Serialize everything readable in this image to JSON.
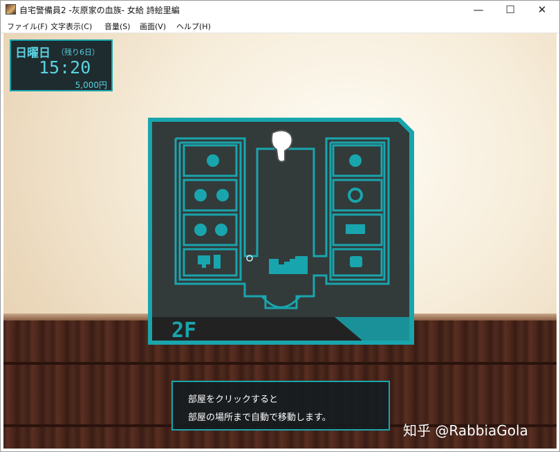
{
  "window": {
    "title": "自宅警備員2 -灰原家の血族- 女給 詩絵里編",
    "minimize_glyph": "—",
    "maximize_glyph": "☐",
    "close_glyph": "✕"
  },
  "menu": {
    "items": [
      "ファイル(F)",
      "文字表示(C)",
      "音量(S)",
      "画面(V)",
      "ヘルプ(H)"
    ]
  },
  "hud": {
    "day": "日曜日",
    "remaining": "（残り6日）",
    "time": "15:20",
    "money": "5,000円"
  },
  "map": {
    "floor_label": "2F",
    "accent_color": "#19a5ad",
    "panel_color": "#333a3a",
    "rooms_left": [
      {
        "icons": [
          "person-icon"
        ]
      },
      {
        "icons": [
          "person-icon",
          "person-icon"
        ]
      },
      {
        "icons": [
          "person-icon",
          "person-icon"
        ]
      },
      {
        "icons": [
          "computer-icon"
        ]
      }
    ],
    "rooms_right": [
      {
        "icons": [
          "person-icon"
        ]
      },
      {
        "icons": [
          "face-icon"
        ]
      },
      {
        "icons": [
          "bed-icon"
        ]
      },
      {
        "icons": [
          "hand-icon"
        ]
      }
    ],
    "cursor_icon": "pointing-hand-icon",
    "stairs_icon": "stairs-icon"
  },
  "message": {
    "line1": "部屋をクリックすると",
    "line2": "部屋の場所まで自動で移動します。"
  },
  "watermark": "知乎 @RabbiaGola"
}
